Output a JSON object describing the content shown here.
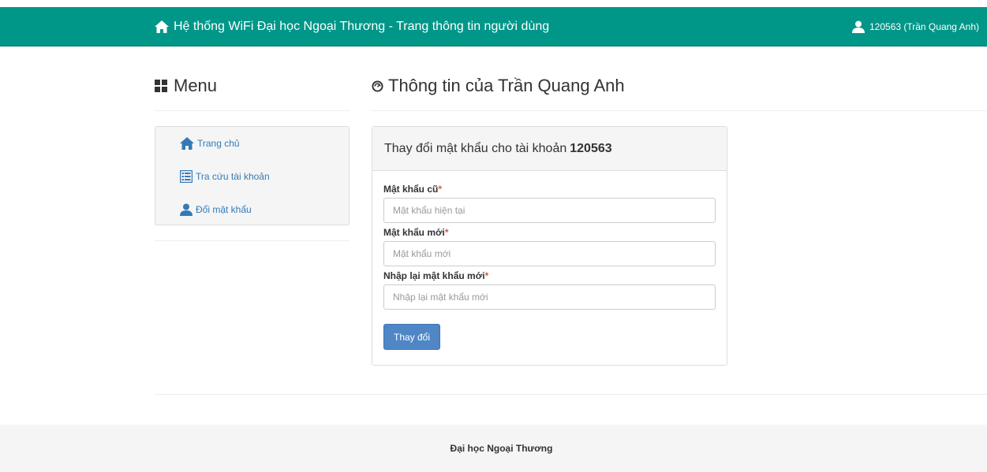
{
  "navbar": {
    "brand_text": "Hệ thống WiFi Đại học Ngoại Thương - Trang thông tin người dùng",
    "brand_icon": "home-icon",
    "user_text": "120563 (Trần Quang Anh)",
    "user_icon": "user-icon",
    "background_color": "#009688"
  },
  "sidebar": {
    "title": "Menu",
    "title_icon": "grid-icon",
    "items": [
      {
        "label": "Trang chủ",
        "icon": "home-icon"
      },
      {
        "label": "Tra cứu tài khoản",
        "icon": "list-icon"
      },
      {
        "label": "Đổi mật khẩu",
        "icon": "user-icon"
      }
    ]
  },
  "main": {
    "title": "Thông tin của Trần Quang Anh",
    "title_icon": "dashboard-icon",
    "panel": {
      "heading": "Thay đổi mật khẩu cho tài khoản",
      "account_id": "120563",
      "fields": [
        {
          "label": "Mật khẩu cũ",
          "required_mark": "*",
          "value": "",
          "placeholder": "Mật khẩu hiện tại"
        },
        {
          "label": "Mật khẩu mới",
          "required_mark": "*",
          "value": "",
          "placeholder": "Mật khẩu mới"
        },
        {
          "label": "Nhập lại mật khẩu mới",
          "required_mark": "*",
          "value": "",
          "placeholder": "Nhập lại mật khẩu mới"
        }
      ],
      "submit_label": "Thay đổi",
      "button_color": "#4f86c6"
    }
  },
  "footer": {
    "text": "Đại học Ngoại Thương"
  }
}
